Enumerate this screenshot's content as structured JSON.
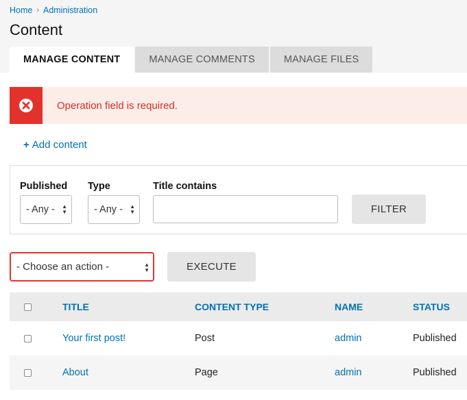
{
  "breadcrumb": {
    "items": [
      "Home",
      "Administration"
    ]
  },
  "page": {
    "title": "Content"
  },
  "tabs": [
    {
      "label": "MANAGE CONTENT",
      "active": true
    },
    {
      "label": "MANAGE COMMENTS",
      "active": false
    },
    {
      "label": "MANAGE FILES",
      "active": false
    }
  ],
  "message": {
    "text": "Operation field is required.",
    "icon": "error-x-icon",
    "color": "#e3322b"
  },
  "add_content": {
    "label": "Add content"
  },
  "filters": {
    "published": {
      "label": "Published",
      "value": "- Any -"
    },
    "type": {
      "label": "Type",
      "value": "- Any -"
    },
    "title": {
      "label": "Title contains",
      "value": ""
    },
    "filter_button": "FILTER"
  },
  "bulk": {
    "action_value": "- Choose an action -",
    "execute_button": "EXECUTE"
  },
  "table": {
    "columns": [
      "TITLE",
      "CONTENT TYPE",
      "NAME",
      "STATUS"
    ],
    "rows": [
      {
        "title": "Your first post!",
        "type": "Post",
        "name": "admin",
        "status": "Published"
      },
      {
        "title": "About",
        "type": "Page",
        "name": "admin",
        "status": "Published"
      }
    ]
  },
  "colors": {
    "link": "#0071b3",
    "error": "#e3322b",
    "error_bg": "#fcede9"
  }
}
